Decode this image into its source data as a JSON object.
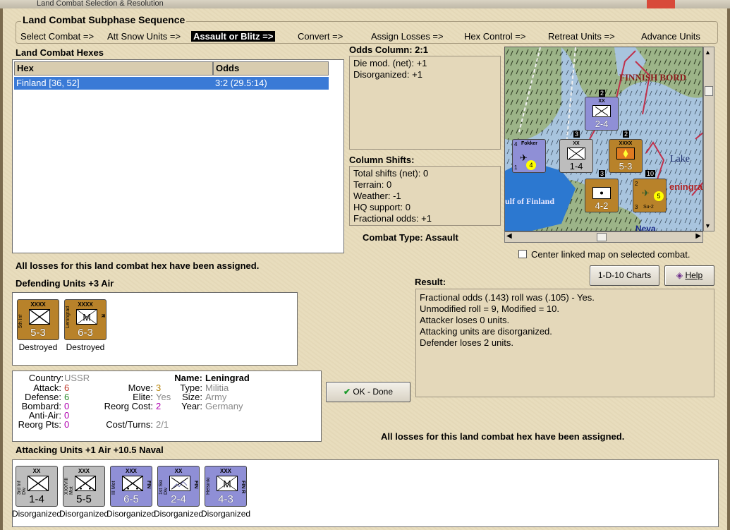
{
  "window": {
    "title": "Land Combat Selection & Resolution"
  },
  "sequence": {
    "title": "Land Combat Subphase Sequence",
    "steps": [
      "Select Combat =>",
      "Att Snow Units =>",
      "Assault or Blitz =>",
      "Convert =>",
      "Assign Losses =>",
      "Hex Control =>",
      "Retreat Units =>",
      "Advance Units"
    ],
    "active_index": 2
  },
  "hexes": {
    "title": "Land Combat Hexes",
    "columns": [
      "Hex",
      "Odds"
    ],
    "rows": [
      {
        "hex": "Finland [36, 52]",
        "odds": "3:2 (29.5:14)"
      }
    ]
  },
  "odds_column": {
    "title": "Odds Column: 2:1",
    "lines": [
      "Die mod. (net): +1",
      "Disorganized: +1"
    ]
  },
  "column_shifts": {
    "title": "Column Shifts:",
    "lines": [
      "Total shifts (net): 0",
      "Terrain: 0",
      "Weather: -1",
      "HQ support: 0",
      "Fractional odds: +1"
    ]
  },
  "combat_type": "Combat Type:  Assault",
  "center_map": {
    "label": "Center linked map on selected combat.",
    "checked": false
  },
  "losses_msg": "All losses for this land combat hex have been assigned.",
  "defending": {
    "title": "Defending Units +3 Air",
    "units": [
      {
        "size": "XXXX",
        "name": "5th Inf",
        "str": "5-3",
        "status": "Destroyed",
        "color": "#b8822a",
        "type": "infantry",
        "tag": ""
      },
      {
        "size": "XXXX",
        "name": "Leningrad",
        "str": "6-3",
        "status": "Destroyed",
        "color": "#b8822a",
        "type": "militia",
        "tag": "R"
      }
    ]
  },
  "unit_info": {
    "country_label": "Country:",
    "country": "USSR",
    "attack_label": "Attack:",
    "attack": "6",
    "defense_label": "Defense:",
    "defense": "6",
    "bombard_label": "Bombard:",
    "bombard": "0",
    "antiair_label": "Anti-Air:",
    "antiair": "0",
    "reorgpts_label": "Reorg Pts:",
    "reorgpts": "0",
    "move_label": "Move:",
    "move": "3",
    "elite_label": "Elite:",
    "elite": "Yes",
    "reorgcost_label": "Reorg Cost:",
    "reorgcost": "2",
    "costturns_label": "Cost/Turns:",
    "costturns": "2/1",
    "name_label": "Name:",
    "name": "Leningrad",
    "type_label": "Type:",
    "type": "Militia",
    "size_label": "Size:",
    "size": "Army",
    "year_label": "Year:",
    "year": "Germany"
  },
  "buttons": {
    "charts": "1-D-10 Charts",
    "help": "Help",
    "ok": "OK - Done"
  },
  "result": {
    "title": "Result:",
    "lines": [
      "Fractional odds (.143) roll was (.105)  - Yes.",
      "Unmodified roll = 9, Modified = 10.",
      "Attacker loses 0 units.",
      "Attacking units are disorganized.",
      "Defender loses 2 units."
    ]
  },
  "attacking": {
    "title": "Attacking Units +1 Air +10.5 Naval",
    "units": [
      {
        "size": "XX",
        "name": "3rd Inf Div",
        "str": "1-4",
        "status": "Disorganized",
        "color": "#bdbdbd",
        "type": "infantry",
        "tag": ""
      },
      {
        "size": "XXX",
        "name": "XXXVIII Mot",
        "str": "5-5",
        "status": "Disorganized",
        "color": "#bdbdbd",
        "type": "motorized",
        "tag": ""
      },
      {
        "size": "XXX",
        "name": "III Mot",
        "str": "6-5",
        "status": "Disorganized",
        "color": "#8f8fd6",
        "type": "motorized",
        "tag": "FIN"
      },
      {
        "size": "XX",
        "name": "1st Ski Div",
        "str": "2-4",
        "status": "Disorganized",
        "color": "#8f8fd6",
        "type": "ski",
        "tag": "FIN"
      },
      {
        "size": "XXX",
        "name": "Helsinki",
        "str": "4-3",
        "status": "Disorganized",
        "color": "#8f8fd6",
        "type": "militia",
        "tag": "FIN R"
      }
    ]
  },
  "map": {
    "labels": [
      "FINNISH BORD",
      "Lake",
      "eningra",
      "ulf of Finland",
      "Neva"
    ],
    "counters": [
      {
        "str": "2-4",
        "size": "XX",
        "type": "ski",
        "color": "#8f8fd6",
        "stack": "2"
      },
      {
        "str": "1-4",
        "size": "XX",
        "type": "infantry",
        "color": "#bdbdbd",
        "stack": "3"
      },
      {
        "str": "5-3",
        "size": "XXXX",
        "type": "burning",
        "color": "#b8822a",
        "stack": "2"
      },
      {
        "str": "4-2",
        "size": "",
        "type": "hq",
        "color": "#b8822a",
        "stack": "3"
      }
    ],
    "air_units": [
      {
        "name": "Fokker",
        "str": "4",
        "extra": "1",
        "badge": "4",
        "color": "#8f8fd6"
      },
      {
        "name": "Su-2",
        "str": "2",
        "extra": "3",
        "badge": "5",
        "color": "#b8822a",
        "stack": "10"
      }
    ]
  }
}
